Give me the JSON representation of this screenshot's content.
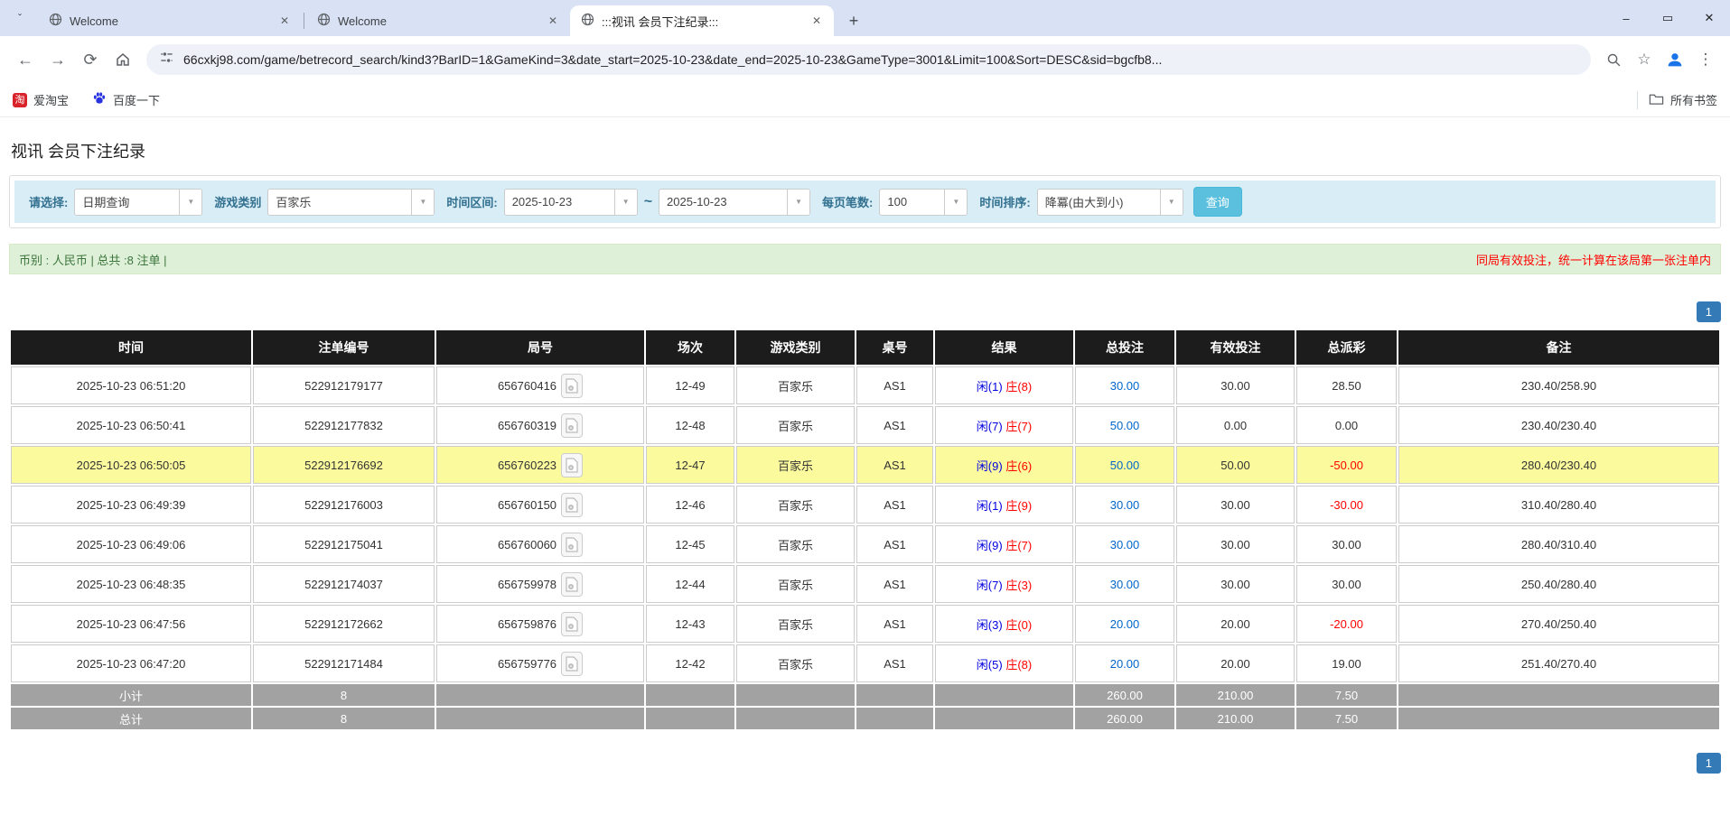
{
  "colors": {
    "accent_button": "#5bc0de",
    "link_blue": "#0066cc",
    "player_blue": "#0000e0",
    "banker_red": "#ff0000",
    "negative_red": "#ff0000",
    "highlight_yellow": "#fbfb9e",
    "header_black": "#1c1c1c",
    "summary_gray": "#a2a2a2",
    "pagination_blue": "#337ab7",
    "filter_bg": "#d9edf7",
    "info_bg": "#dff0d8",
    "info_text_green": "#3c763d"
  },
  "browser": {
    "tabs": [
      {
        "title": "Welcome"
      },
      {
        "title": "Welcome"
      },
      {
        "title": ":::视讯 会员下注纪录:::"
      }
    ],
    "url": "66cxkj98.com/game/betrecord_search/kind3?BarID=1&GameKind=3&date_start=2025-10-23&date_end=2025-10-23&GameType=3001&Limit=100&Sort=DESC&sid=bgcfb8...",
    "bookmarks": [
      {
        "icon_text": "淘",
        "label": "爱淘宝"
      },
      {
        "label": "百度一下"
      }
    ],
    "all_bookmarks_label": "所有书签"
  },
  "page": {
    "title": "视讯 会员下注纪录",
    "filters": {
      "select_label": "请选择:",
      "select_value": "日期查询",
      "game_type_label": "游戏类别",
      "game_type_value": "百家乐",
      "date_range_label": "时间区间:",
      "date_start": "2025-10-23",
      "tilde": "~",
      "date_end": "2025-10-23",
      "page_size_label": "每页笔数:",
      "page_size_value": "100",
      "sort_label": "时间排序:",
      "sort_value": "降冪(由大到小)",
      "search_button": "查询"
    },
    "info_bar": {
      "left": "币别 : 人民币 | 总共 :8 注单 |",
      "right": "同局有效投注，统一计算在该局第一张注单内"
    },
    "pagination_label": "1",
    "table": {
      "headers": [
        "时间",
        "注单编号",
        "局号",
        "场次",
        "游戏类别",
        "桌号",
        "结果",
        "总投注",
        "有效投注",
        "总派彩",
        "备注"
      ],
      "rows": [
        {
          "time": "2025-10-23 06:51:20",
          "bet_id": "522912179177",
          "round": "656760416",
          "session": "12-49",
          "game": "百家乐",
          "table_no": "AS1",
          "result_player": "闲(1)",
          "result_banker": "庄(8)",
          "total_bet": "30.00",
          "valid_bet": "30.00",
          "payout": "28.50",
          "note": "230.40/258.90",
          "highlight": false
        },
        {
          "time": "2025-10-23 06:50:41",
          "bet_id": "522912177832",
          "round": "656760319",
          "session": "12-48",
          "game": "百家乐",
          "table_no": "AS1",
          "result_player": "闲(7)",
          "result_banker": "庄(7)",
          "total_bet": "50.00",
          "valid_bet": "0.00",
          "payout": "0.00",
          "note": "230.40/230.40",
          "highlight": false
        },
        {
          "time": "2025-10-23 06:50:05",
          "bet_id": "522912176692",
          "round": "656760223",
          "session": "12-47",
          "game": "百家乐",
          "table_no": "AS1",
          "result_player": "闲(9)",
          "result_banker": "庄(6)",
          "total_bet": "50.00",
          "valid_bet": "50.00",
          "payout": "-50.00",
          "note": "280.40/230.40",
          "highlight": true
        },
        {
          "time": "2025-10-23 06:49:39",
          "bet_id": "522912176003",
          "round": "656760150",
          "session": "12-46",
          "game": "百家乐",
          "table_no": "AS1",
          "result_player": "闲(1)",
          "result_banker": "庄(9)",
          "total_bet": "30.00",
          "valid_bet": "30.00",
          "payout": "-30.00",
          "note": "310.40/280.40",
          "highlight": false
        },
        {
          "time": "2025-10-23 06:49:06",
          "bet_id": "522912175041",
          "round": "656760060",
          "session": "12-45",
          "game": "百家乐",
          "table_no": "AS1",
          "result_player": "闲(9)",
          "result_banker": "庄(7)",
          "total_bet": "30.00",
          "valid_bet": "30.00",
          "payout": "30.00",
          "note": "280.40/310.40",
          "highlight": false
        },
        {
          "time": "2025-10-23 06:48:35",
          "bet_id": "522912174037",
          "round": "656759978",
          "session": "12-44",
          "game": "百家乐",
          "table_no": "AS1",
          "result_player": "闲(7)",
          "result_banker": "庄(3)",
          "total_bet": "30.00",
          "valid_bet": "30.00",
          "payout": "30.00",
          "note": "250.40/280.40",
          "highlight": false
        },
        {
          "time": "2025-10-23 06:47:56",
          "bet_id": "522912172662",
          "round": "656759876",
          "session": "12-43",
          "game": "百家乐",
          "table_no": "AS1",
          "result_player": "闲(3)",
          "result_banker": "庄(0)",
          "total_bet": "20.00",
          "valid_bet": "20.00",
          "payout": "-20.00",
          "note": "270.40/250.40",
          "highlight": false
        },
        {
          "time": "2025-10-23 06:47:20",
          "bet_id": "522912171484",
          "round": "656759776",
          "session": "12-42",
          "game": "百家乐",
          "table_no": "AS1",
          "result_player": "闲(5)",
          "result_banker": "庄(8)",
          "total_bet": "20.00",
          "valid_bet": "20.00",
          "payout": "19.00",
          "note": "251.40/270.40",
          "highlight": false
        }
      ],
      "subtotal": {
        "label": "小计",
        "count": "8",
        "total_bet": "260.00",
        "valid_bet": "210.00",
        "payout": "7.50"
      },
      "total": {
        "label": "总计",
        "count": "8",
        "total_bet": "260.00",
        "valid_bet": "210.00",
        "payout": "7.50"
      }
    }
  }
}
